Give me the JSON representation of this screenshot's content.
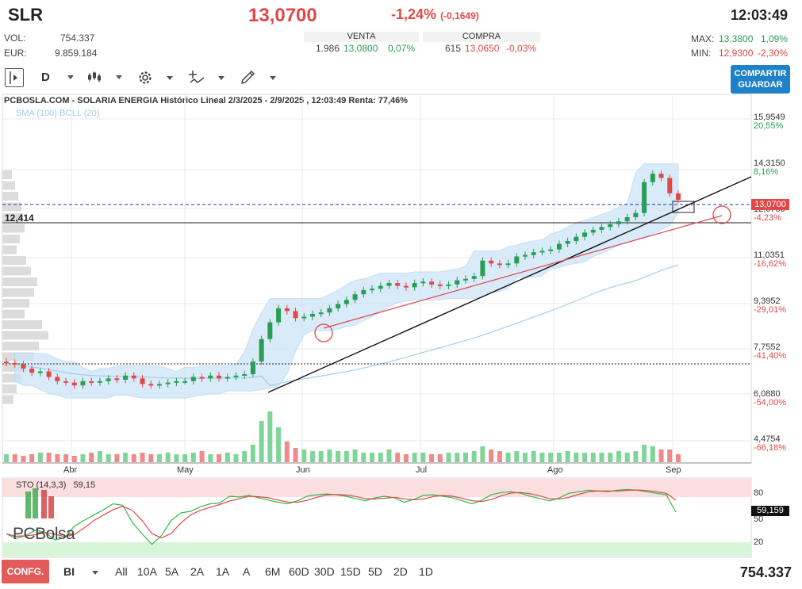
{
  "header": {
    "ticker": "SLR",
    "price": "13,0700",
    "change_pct": "-1,24%",
    "change_abs": "(-0,1649)",
    "time": "12:03:49"
  },
  "stats": {
    "vol_label": "VOL:",
    "vol_value": "754.337",
    "eur_label": "EUR:",
    "eur_value": "9.859.184",
    "max_label": "MAX:",
    "max_value": "13,3800",
    "max_pct": "1,09%",
    "min_label": "MIN:",
    "min_value": "12,9300",
    "min_pct": "-2,30%"
  },
  "book": {
    "venta_label": "VENTA",
    "venta_qty": "1.986",
    "venta_price": "13,0800",
    "venta_pct": "0,07%",
    "compra_label": "COMPRA",
    "compra_qty": "615",
    "compra_price": "13,0650",
    "compra_pct": "-0,03%"
  },
  "toolbar": {
    "interval": "D",
    "share_label": "COMPARTIR",
    "save_label": "GUARDAR"
  },
  "chart": {
    "title": "PCBOSLA.COM - SOLARIA ENERGIA Histórico Lineal 2/3/2025 - 2/9/2025 , 12:03:49 Renta: 77,46%",
    "indicators": "SMA (100) BOLL (20)",
    "support_label": "12,414",
    "price_tag": "13,0700",
    "stoch_label": "STO (14,3,3)",
    "stoch_value": "59,15",
    "stoch_tag": "59,159",
    "stoch_levels": [
      "80",
      "50",
      "20"
    ],
    "logo_text": "PCBolsa",
    "accent_green": "#2a9d55",
    "accent_red": "#e04848"
  },
  "chart_data": {
    "type": "line",
    "title": "PCBOSLA.COM - SOLARIA ENERGIA Histórico Lineal 2/3/2025 - 2/9/2025 , 12:03:49 Renta: 77,46%",
    "x_tick_labels": [
      "Abr",
      "May",
      "Jun",
      "Jul",
      "Ago",
      "Sep"
    ],
    "y_tick_labels": [
      {
        "value": "15,9549",
        "pct": "20,55%"
      },
      {
        "value": "14,3150",
        "pct": "8,16%"
      },
      {
        "value": "12,6750",
        "pct": "-4,23%"
      },
      {
        "value": "11,0351",
        "pct": "-16,62%"
      },
      {
        "value": "9,3952",
        "pct": "-29,01%"
      },
      {
        "value": "7,7552",
        "pct": "-41,40%"
      },
      {
        "value": "6,0880",
        "pct": "-54,00%"
      },
      {
        "value": "4,4754",
        "pct": "-66,18%"
      }
    ],
    "ylim": [
      4.4754,
      15.9549
    ],
    "close_series": [
      7.25,
      7.2,
      7.05,
      6.9,
      6.95,
      6.75,
      6.6,
      6.55,
      6.45,
      6.6,
      6.55,
      6.6,
      6.7,
      6.65,
      6.8,
      6.7,
      6.5,
      6.45,
      6.5,
      6.55,
      6.6,
      6.6,
      6.75,
      6.7,
      6.8,
      6.7,
      6.75,
      6.8,
      6.85,
      7.3,
      8.1,
      8.7,
      9.2,
      9.1,
      8.85,
      8.9,
      9.0,
      9.05,
      9.2,
      9.35,
      9.5,
      9.7,
      9.85,
      9.9,
      10.0,
      10.1,
      10.0,
      9.95,
      10.1,
      10.15,
      10.05,
      10.0,
      10.05,
      10.2,
      10.25,
      10.35,
      10.9,
      10.8,
      10.75,
      10.8,
      11.05,
      11.1,
      11.2,
      11.25,
      11.3,
      11.5,
      11.6,
      11.75,
      11.9,
      12.0,
      12.1,
      12.2,
      12.3,
      12.45,
      12.6,
      13.7,
      14.0,
      13.85,
      13.3,
      13.07
    ],
    "volume": [
      0.5,
      0.5,
      0.4,
      0.5,
      0.6,
      0.6,
      0.5,
      0.5,
      0.4,
      0.5,
      0.6,
      0.7,
      0.5,
      0.5,
      0.6,
      0.5,
      0.6,
      0.5,
      0.5,
      0.6,
      0.5,
      0.5,
      0.6,
      0.7,
      0.5,
      0.5,
      0.6,
      0.5,
      0.7,
      1.1,
      2.6,
      3.2,
      2.2,
      1.3,
      0.9,
      0.8,
      0.7,
      0.7,
      0.8,
      0.7,
      0.7,
      0.8,
      0.6,
      0.6,
      0.6,
      0.8,
      0.6,
      0.5,
      0.6,
      0.6,
      0.5,
      0.5,
      0.6,
      0.6,
      0.6,
      0.7,
      1.0,
      0.8,
      0.7,
      0.6,
      0.7,
      0.6,
      0.7,
      0.6,
      0.6,
      0.6,
      0.7,
      0.6,
      0.6,
      0.6,
      0.6,
      0.6,
      0.7,
      0.6,
      0.7,
      1.1,
      1.0,
      0.8,
      0.8,
      0.5
    ],
    "stochastic": [
      30,
      24,
      28,
      35,
      32,
      22,
      25,
      40,
      48,
      55,
      62,
      70,
      68,
      45,
      30,
      16,
      28,
      48,
      58,
      60,
      66,
      70,
      71,
      80,
      79,
      81,
      78,
      75,
      72,
      70,
      74,
      80,
      82,
      83,
      82,
      80,
      77,
      74,
      78,
      80,
      78,
      72,
      76,
      81,
      82,
      80,
      78,
      74,
      70,
      75,
      82,
      85,
      86,
      84,
      80,
      77,
      74,
      78,
      84,
      86,
      88,
      87,
      86,
      88,
      89,
      88,
      86,
      84,
      82,
      59
    ],
    "overbought": 80,
    "oversold": 20,
    "grid": true
  },
  "periods": [
    "BI",
    "All",
    "10A",
    "5A",
    "2A",
    "1A",
    "A",
    "6M",
    "60D",
    "30D",
    "15D",
    "5D",
    "2D",
    "1D"
  ],
  "footer": {
    "config_label": "CONFG.",
    "last_volume": "754.337"
  }
}
